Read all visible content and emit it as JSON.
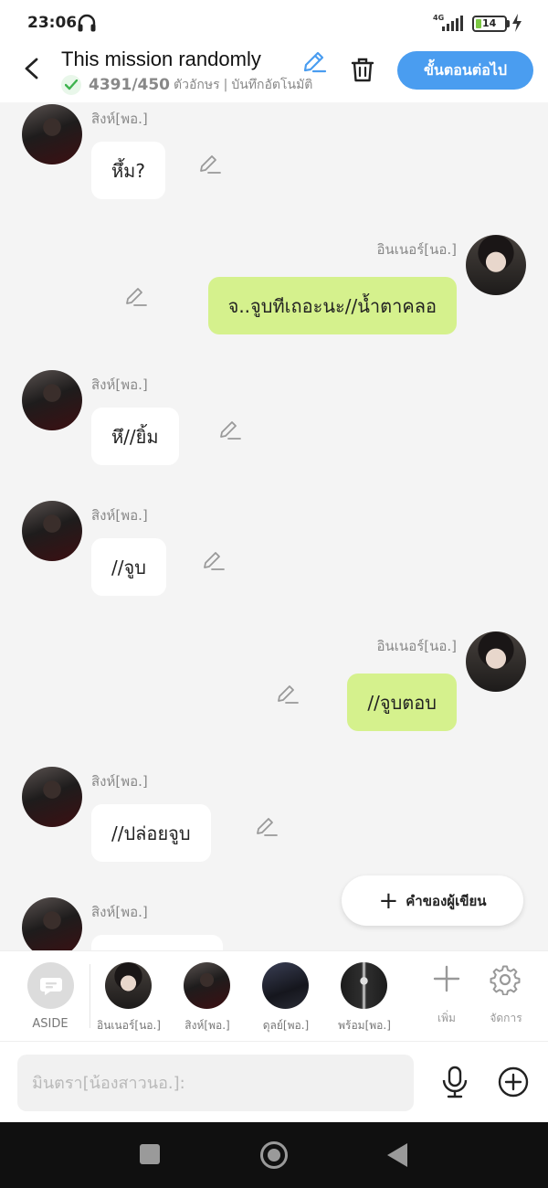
{
  "status": {
    "time": "23:06",
    "network": "4G",
    "battery": "14"
  },
  "header": {
    "title": "This mission randomly",
    "count": "4391/450",
    "count_unit": "ตัวอักษร",
    "separator": "|",
    "autosave": "บันทึกอัตโนมัติ",
    "next_label": "ขั้นตอนต่อไป"
  },
  "messages": [
    {
      "side": "left",
      "speaker": "สิงห์[พอ.]",
      "text": "หึ้ม?"
    },
    {
      "side": "right",
      "speaker": "อินเนอร์[นอ.]",
      "text": "จ..จูบทีเถอะนะ//น้ำตาคลอ"
    },
    {
      "side": "left",
      "speaker": "สิงห์[พอ.]",
      "text": "หึ//ยิ้ม"
    },
    {
      "side": "left",
      "speaker": "สิงห์[พอ.]",
      "text": "//จูบ"
    },
    {
      "side": "right",
      "speaker": "อินเนอร์[นอ.]",
      "text": "//จูบตอบ"
    },
    {
      "side": "left",
      "speaker": "สิงห์[พอ.]",
      "text": "//ปล่อยจูบ"
    },
    {
      "side": "left",
      "speaker": "สิงห์[พอ.]",
      "text": ""
    }
  ],
  "author_button": "คำของผู้เขียน",
  "characters": {
    "aside": "ASIDE",
    "items": [
      "อินเนอร์[นอ.]",
      "สิงห์[พอ.]",
      "ดุลย์[พอ.]",
      "พร้อม[พอ.]"
    ],
    "add_label": "เพิ่ม",
    "manage_label": "จัดการ"
  },
  "input": {
    "placeholder": "มินตรา[น้องสาวนอ.]:"
  },
  "colors": {
    "accent": "#4a9df0",
    "bubble_right": "#d5f18d",
    "bubble_left": "#ffffff"
  }
}
